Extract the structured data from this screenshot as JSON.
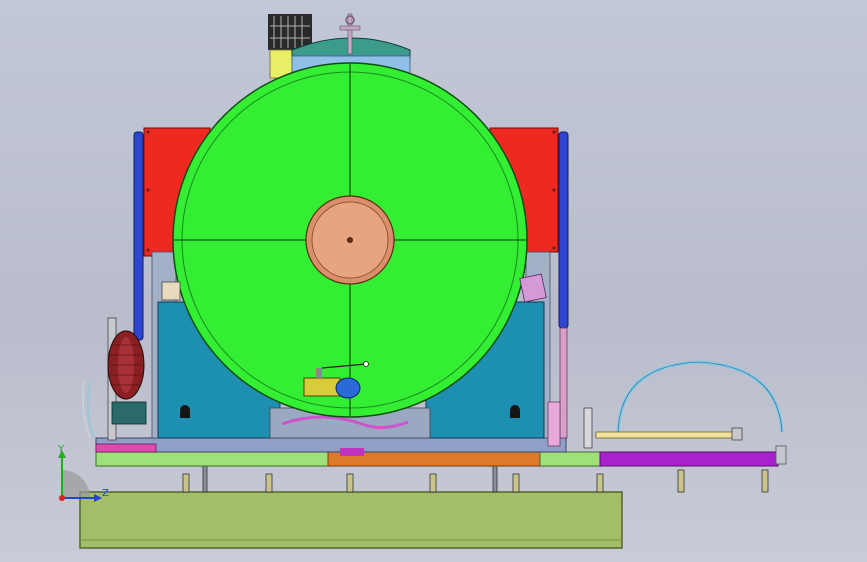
{
  "viewport": {
    "background_top": "#c3c8d8",
    "background_bottom": "#c9ccd6"
  },
  "triad": {
    "y_label": "Y",
    "z_label": "Z",
    "y_color": "#22aa22",
    "z_color": "#2244dd",
    "x_color": "#dd2222"
  },
  "colors": {
    "tank_green": "#33ee33",
    "frame_red": "#ee2a20",
    "hull_teal": "#1d8fb0",
    "base_olive": "#a3bd68",
    "dome_teal": "#3c9c8c",
    "flange_copper": "#d9906a",
    "rail_purple": "#a822cc",
    "rail_orange": "#dd7a2a",
    "rail_lightgreen": "#9fe07a",
    "post_blue": "#2e45d0"
  },
  "icons": {
    "triad": "coordinate-triad-icon",
    "handwheel": "handwheel-icon",
    "valve": "ball-valve-icon"
  }
}
